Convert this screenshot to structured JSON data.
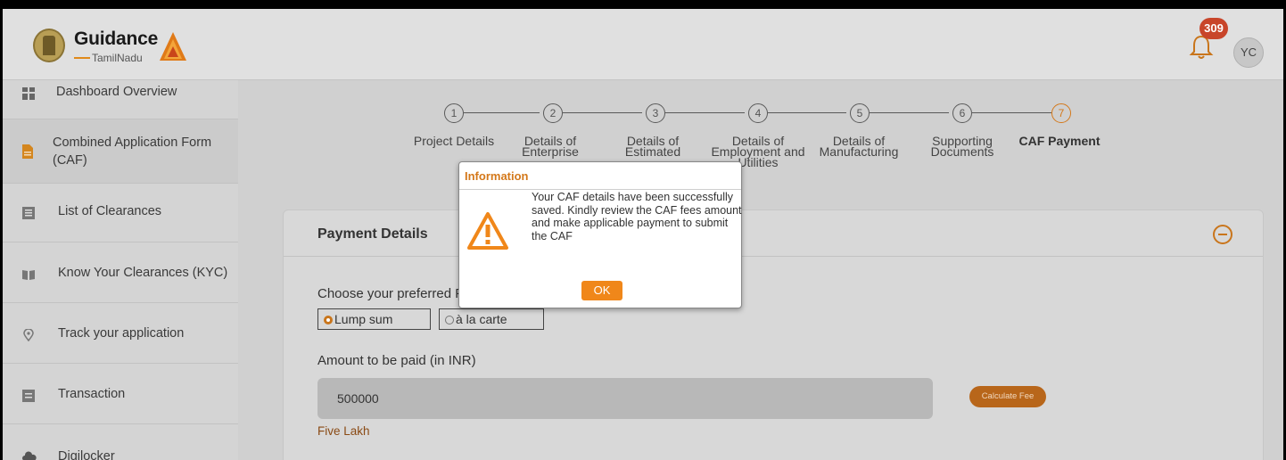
{
  "header": {
    "logo_main": "Guidance",
    "logo_sub": "TamilNadu",
    "notification_count": "309",
    "user_initials": "YC"
  },
  "sidebar": {
    "items": [
      {
        "label": "Dashboard Overview",
        "icon": "dashboard-grid-icon"
      },
      {
        "label": "Combined Application Form (CAF)",
        "icon": "document-icon",
        "active": true
      },
      {
        "label": "List of Clearances",
        "icon": "list-icon"
      },
      {
        "label": "Know Your Clearances (KYC)",
        "icon": "book-icon"
      },
      {
        "label": "Track your application",
        "icon": "location-pin-icon"
      },
      {
        "label": "Transaction",
        "icon": "transaction-icon"
      },
      {
        "label": "Digilocker",
        "icon": "cloud-icon"
      }
    ]
  },
  "stepper": {
    "steps": [
      {
        "num": "1",
        "label": "Project Details"
      },
      {
        "num": "2",
        "label": "Details of Enterprise"
      },
      {
        "num": "3",
        "label": "Details of Estimated"
      },
      {
        "num": "4",
        "label": "Details of Employment and Utilities"
      },
      {
        "num": "5",
        "label": "Details of Manufacturing"
      },
      {
        "num": "6",
        "label": "Supporting Documents"
      },
      {
        "num": "7",
        "label": "CAF Payment",
        "active": true
      }
    ]
  },
  "payment": {
    "title": "Payment Details",
    "fee_label": "Choose your preferred Fee slab *",
    "options": [
      "Lump sum",
      "à la carte"
    ],
    "selected_option": "Lump sum",
    "amount_label": "Amount to be paid (in INR)",
    "amount_value": "500000",
    "calculate_button": "Calculate Fee",
    "amount_in_words": "Five Lakh"
  },
  "modal": {
    "title": "Information",
    "message": "Your CAF details have been successfully saved. Kindly review the CAF fees amount and make applicable payment to submit the CAF",
    "ok_label": "OK",
    "icon": "warning-triangle-icon"
  },
  "colors": {
    "accent": "#f0871a",
    "badge": "#c8452a",
    "overlay": "#d0d0d0"
  }
}
